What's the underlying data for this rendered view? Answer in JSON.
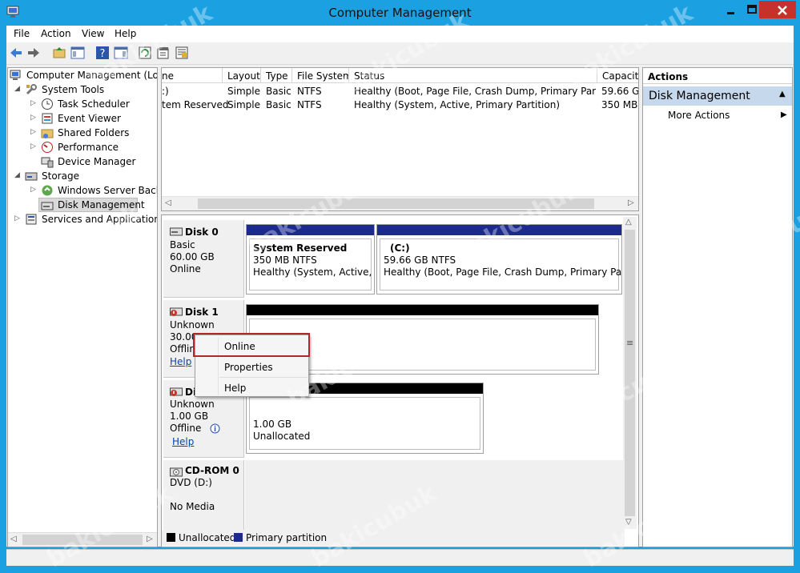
{
  "window": {
    "title": "Computer Management"
  },
  "menu": [
    "File",
    "Action",
    "View",
    "Help"
  ],
  "tree": {
    "root": "Computer Management (Local",
    "items": [
      {
        "label": "System Tools",
        "level": 1,
        "expanded": true
      },
      {
        "label": "Task Scheduler",
        "level": 2
      },
      {
        "label": "Event Viewer",
        "level": 2
      },
      {
        "label": "Shared Folders",
        "level": 2
      },
      {
        "label": "Performance",
        "level": 2
      },
      {
        "label": "Device Manager",
        "level": 2
      },
      {
        "label": "Storage",
        "level": 1,
        "expanded": true
      },
      {
        "label": "Windows Server Backup",
        "level": 2
      },
      {
        "label": "Disk Management",
        "level": 2,
        "selected": true
      },
      {
        "label": "Services and Applications",
        "level": 1
      }
    ]
  },
  "volumes": {
    "columns": [
      "ne",
      "Layout",
      "Type",
      "File System",
      "Status",
      "Capacity"
    ],
    "rows": [
      [
        ":)",
        "Simple",
        "Basic",
        "NTFS",
        "Healthy (Boot, Page File, Crash Dump, Primary Partition)",
        "59.66 GB"
      ],
      [
        "tem Reserved",
        "Simple",
        "Basic",
        "NTFS",
        "Healthy (System, Active, Primary Partition)",
        "350 MB"
      ]
    ]
  },
  "disks": {
    "disk0": {
      "label": [
        "Disk 0",
        "Basic",
        "60.00 GB",
        "Online"
      ],
      "part1": [
        "System Reserved",
        "350 MB NTFS",
        "Healthy (System, Active, Pri"
      ],
      "part2": [
        "(C:)",
        "59.66 GB NTFS",
        "Healthy (Boot, Page File, Crash Dump, Primary Partition"
      ]
    },
    "disk1": {
      "label": [
        "Disk 1",
        "Unknown",
        "30.00 GB",
        "Offline",
        "Help"
      ]
    },
    "disk2": {
      "label": [
        "Dis",
        "Unknown",
        "1.00 GB",
        "Offline",
        "Help"
      ],
      "part": [
        "1.00 GB",
        "Unallocated"
      ]
    },
    "cdrom": {
      "label": [
        "CD-ROM 0",
        "DVD (D:)",
        "No Media"
      ]
    }
  },
  "legend": {
    "unallocated": "Unallocated",
    "primary": "Primary partition"
  },
  "context_menu": [
    "Online",
    "Properties",
    "Help"
  ],
  "actions": {
    "header": "Actions",
    "section": "Disk Management",
    "items": [
      "More Actions"
    ]
  },
  "watermark": "bakicubuk",
  "colors": {
    "titlebar": "#1ba1e2",
    "primary_partition": "#1c2a8c",
    "unallocated": "#000000",
    "highlight": "#b0272c",
    "close": "#c7312b"
  }
}
